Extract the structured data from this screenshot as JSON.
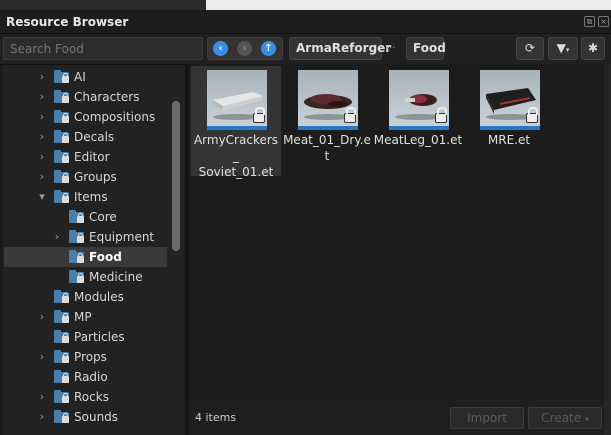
{
  "window": {
    "title": "Resource Browser"
  },
  "toolbar": {
    "search_placeholder": "Search Food",
    "breadcrumbs": [
      "ArmaReforger",
      "Food"
    ],
    "breadcrumb_separator": "›··"
  },
  "tree": {
    "items": [
      {
        "label": "AI",
        "level": 0,
        "expanded": false,
        "has_children": true,
        "selected": false
      },
      {
        "label": "Characters",
        "level": 0,
        "expanded": false,
        "has_children": true,
        "selected": false
      },
      {
        "label": "Compositions",
        "level": 0,
        "expanded": false,
        "has_children": true,
        "selected": false
      },
      {
        "label": "Decals",
        "level": 0,
        "expanded": false,
        "has_children": true,
        "selected": false
      },
      {
        "label": "Editor",
        "level": 0,
        "expanded": false,
        "has_children": true,
        "selected": false
      },
      {
        "label": "Groups",
        "level": 0,
        "expanded": false,
        "has_children": true,
        "selected": false
      },
      {
        "label": "Items",
        "level": 0,
        "expanded": true,
        "has_children": true,
        "selected": false
      },
      {
        "label": "Core",
        "level": 1,
        "expanded": false,
        "has_children": false,
        "selected": false
      },
      {
        "label": "Equipment",
        "level": 1,
        "expanded": false,
        "has_children": true,
        "selected": false
      },
      {
        "label": "Food",
        "level": 1,
        "expanded": false,
        "has_children": false,
        "selected": true
      },
      {
        "label": "Medicine",
        "level": 1,
        "expanded": false,
        "has_children": false,
        "selected": false
      },
      {
        "label": "Modules",
        "level": 0,
        "expanded": false,
        "has_children": false,
        "selected": false
      },
      {
        "label": "MP",
        "level": 0,
        "expanded": false,
        "has_children": true,
        "selected": false
      },
      {
        "label": "Particles",
        "level": 0,
        "expanded": false,
        "has_children": false,
        "selected": false
      },
      {
        "label": "Props",
        "level": 0,
        "expanded": false,
        "has_children": true,
        "selected": false
      },
      {
        "label": "Radio",
        "level": 0,
        "expanded": false,
        "has_children": false,
        "selected": false
      },
      {
        "label": "Rocks",
        "level": 0,
        "expanded": false,
        "has_children": true,
        "selected": false
      },
      {
        "label": "Sounds",
        "level": 0,
        "expanded": false,
        "has_children": true,
        "selected": false
      }
    ]
  },
  "grid": {
    "items": [
      {
        "name": "ArmyCrackers_\nSoviet_01.et",
        "selected": true,
        "icon": "crackers-box-model",
        "locked": true
      },
      {
        "name": "Meat_01_Dry.et",
        "selected": false,
        "icon": "dried-meat-model",
        "locked": true
      },
      {
        "name": "MeatLeg_01.et",
        "selected": false,
        "icon": "meat-leg-model",
        "locked": true
      },
      {
        "name": "MRE.et",
        "selected": false,
        "icon": "mre-pouch-model",
        "locked": true
      }
    ]
  },
  "footer": {
    "item_count": "4 items",
    "import_label": "Import",
    "create_label": "Create"
  },
  "colors": {
    "accent": "#2878c8",
    "folder": "#4a7fa9",
    "nav_active": "#3a8ee6",
    "nav_disabled": "#555555"
  }
}
